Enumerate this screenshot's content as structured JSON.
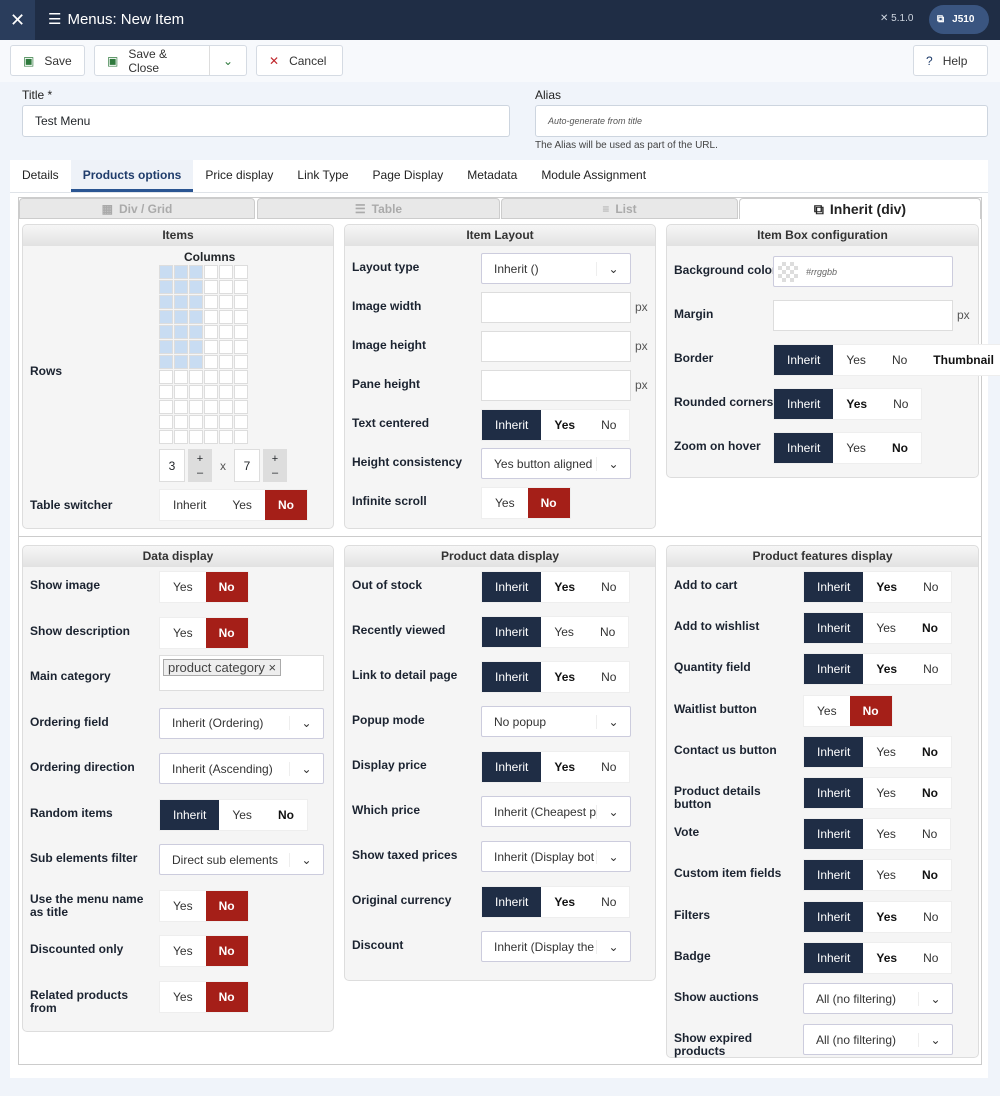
{
  "header": {
    "title": "Menus: New Item",
    "version": "5.1.0",
    "user": "J510"
  },
  "toolbar": {
    "save": "Save",
    "save_close": "Save & Close",
    "cancel": "Cancel",
    "help": "Help"
  },
  "form": {
    "title_label": "Title *",
    "title_value": "Test Menu",
    "alias_label": "Alias",
    "alias_placeholder": "Auto-generate from title",
    "alias_hint": "The Alias will be used as part of the URL."
  },
  "tabs": [
    "Details",
    "Products options",
    "Price display",
    "Link Type",
    "Page Display",
    "Metadata",
    "Module Assignment"
  ],
  "active_tab": 1,
  "layout_tabs": [
    "Div / Grid",
    "Table",
    "List",
    "Inherit (div)"
  ],
  "colors": {
    "dark": "#1f2d45",
    "red": "#a51f18",
    "grid_fill": "#c8dcf2"
  },
  "items": {
    "title": "Items",
    "columns_label": "Columns",
    "rows_label": "Rows",
    "columns": 3,
    "rows": 7,
    "grid_cols": 6,
    "grid_rows": 12,
    "times": "x",
    "plus": "+",
    "minus": "–",
    "table_switcher": {
      "label": "Table switcher",
      "options": [
        "Inherit",
        "Yes",
        "No"
      ],
      "active": 2,
      "bold": []
    }
  },
  "panels": [
    {
      "id": "item-layout",
      "title": "Item Layout",
      "rows": [
        {
          "label": "Layout type",
          "type": "select",
          "value": "Inherit ()"
        },
        {
          "label": "Image width",
          "type": "input",
          "suffix": "px"
        },
        {
          "label": "Image height",
          "type": "input",
          "suffix": "px"
        },
        {
          "label": "Pane height",
          "type": "input",
          "suffix": "px"
        },
        {
          "label": "Text centered",
          "type": "toggle",
          "options": [
            "Inherit",
            "Yes",
            "No"
          ],
          "active": 0,
          "bold": [
            1
          ]
        },
        {
          "label": "Height consistency",
          "type": "select",
          "value": "Yes button aligned"
        },
        {
          "label": "Infinite scroll",
          "type": "toggle",
          "options": [
            "Yes",
            "No"
          ],
          "active": 1,
          "bold": []
        }
      ]
    },
    {
      "id": "item-box",
      "title": "Item Box configuration",
      "rows": [
        {
          "label": "Background color",
          "type": "color",
          "placeholder": "#rrggbb"
        },
        {
          "label": "Margin",
          "type": "input",
          "suffix": "px"
        },
        {
          "label": "Border",
          "type": "toggle",
          "options": [
            "Inherit",
            "Yes",
            "No",
            "Thumbnail"
          ],
          "active": 0,
          "bold": [
            3
          ]
        },
        {
          "label": "Rounded corners",
          "type": "toggle",
          "options": [
            "Inherit",
            "Yes",
            "No"
          ],
          "active": 0,
          "bold": [
            1
          ]
        },
        {
          "label": "Zoom on hover",
          "type": "toggle",
          "options": [
            "Inherit",
            "Yes",
            "No"
          ],
          "active": 0,
          "bold": [
            2
          ]
        }
      ]
    },
    {
      "id": "data-display",
      "title": "Data display",
      "rows": [
        {
          "label": "Show image",
          "type": "toggle",
          "options": [
            "Yes",
            "No"
          ],
          "active": 1,
          "bold": []
        },
        {
          "label": "Show description",
          "type": "toggle",
          "options": [
            "Yes",
            "No"
          ],
          "active": 1,
          "bold": []
        },
        {
          "label": "Main category",
          "type": "tags",
          "tag": "product category"
        },
        {
          "label": "Ordering field",
          "type": "select",
          "value": "Inherit (Ordering)"
        },
        {
          "label": "Ordering direction",
          "type": "select",
          "value": "Inherit (Ascending)"
        },
        {
          "label": "Random items",
          "type": "toggle",
          "options": [
            "Inherit",
            "Yes",
            "No"
          ],
          "active": 0,
          "bold": [
            2
          ]
        },
        {
          "label": "Sub elements filter",
          "type": "select",
          "value": "Direct sub elements"
        },
        {
          "label": "Use the menu name as title",
          "type": "toggle",
          "options": [
            "Yes",
            "No"
          ],
          "active": 1,
          "bold": []
        },
        {
          "label": "Discounted only",
          "type": "toggle",
          "options": [
            "Yes",
            "No"
          ],
          "active": 1,
          "bold": []
        },
        {
          "label": "Related products from",
          "type": "toggle",
          "options": [
            "Yes",
            "No"
          ],
          "active": 1,
          "bold": []
        }
      ]
    },
    {
      "id": "product-data",
      "title": "Product data display",
      "rows": [
        {
          "label": "Out of stock",
          "type": "toggle",
          "options": [
            "Inherit",
            "Yes",
            "No"
          ],
          "active": 0,
          "bold": [
            1
          ]
        },
        {
          "label": "Recently viewed",
          "type": "toggle",
          "options": [
            "Inherit",
            "Yes",
            "No"
          ],
          "active": 0,
          "bold": []
        },
        {
          "label": "Link to detail page",
          "type": "toggle",
          "options": [
            "Inherit",
            "Yes",
            "No"
          ],
          "active": 0,
          "bold": [
            1
          ]
        },
        {
          "label": "Popup mode",
          "type": "select",
          "value": "No popup"
        },
        {
          "label": "Display price",
          "type": "toggle",
          "options": [
            "Inherit",
            "Yes",
            "No"
          ],
          "active": 0,
          "bold": [
            1
          ]
        },
        {
          "label": "Which price",
          "type": "select",
          "value": "Inherit (Cheapest p"
        },
        {
          "label": "Show taxed prices",
          "type": "select",
          "value": "Inherit (Display bot"
        },
        {
          "label": "Original currency",
          "type": "toggle",
          "options": [
            "Inherit",
            "Yes",
            "No"
          ],
          "active": 0,
          "bold": [
            1
          ]
        },
        {
          "label": "Discount",
          "type": "select",
          "value": "Inherit (Display the"
        }
      ]
    },
    {
      "id": "product-features",
      "title": "Product features display",
      "rows": [
        {
          "label": "Add to cart",
          "type": "toggle",
          "options": [
            "Inherit",
            "Yes",
            "No"
          ],
          "active": 0,
          "bold": [
            1
          ]
        },
        {
          "label": "Add to wishlist",
          "type": "toggle",
          "options": [
            "Inherit",
            "Yes",
            "No"
          ],
          "active": 0,
          "bold": [
            2
          ]
        },
        {
          "label": "Quantity field",
          "type": "toggle",
          "options": [
            "Inherit",
            "Yes",
            "No"
          ],
          "active": 0,
          "bold": [
            1
          ]
        },
        {
          "label": "Waitlist button",
          "type": "toggle",
          "options": [
            "Yes",
            "No"
          ],
          "active": 1,
          "bold": []
        },
        {
          "label": "Contact us button",
          "type": "toggle",
          "options": [
            "Inherit",
            "Yes",
            "No"
          ],
          "active": 0,
          "bold": [
            2
          ]
        },
        {
          "label": "Product details button",
          "type": "toggle",
          "options": [
            "Inherit",
            "Yes",
            "No"
          ],
          "active": 0,
          "bold": [
            2
          ]
        },
        {
          "label": "Vote",
          "type": "toggle",
          "options": [
            "Inherit",
            "Yes",
            "No"
          ],
          "active": 0,
          "bold": []
        },
        {
          "label": "Custom item fields",
          "type": "toggle",
          "options": [
            "Inherit",
            "Yes",
            "No"
          ],
          "active": 0,
          "bold": [
            2
          ]
        },
        {
          "label": "Filters",
          "type": "toggle",
          "options": [
            "Inherit",
            "Yes",
            "No"
          ],
          "active": 0,
          "bold": [
            1
          ]
        },
        {
          "label": "Badge",
          "type": "toggle",
          "options": [
            "Inherit",
            "Yes",
            "No"
          ],
          "active": 0,
          "bold": [
            1
          ]
        },
        {
          "label": "Show auctions",
          "type": "select",
          "value": "All (no filtering)"
        },
        {
          "label": "Show expired products",
          "type": "select",
          "value": "All (no filtering)"
        }
      ]
    }
  ]
}
